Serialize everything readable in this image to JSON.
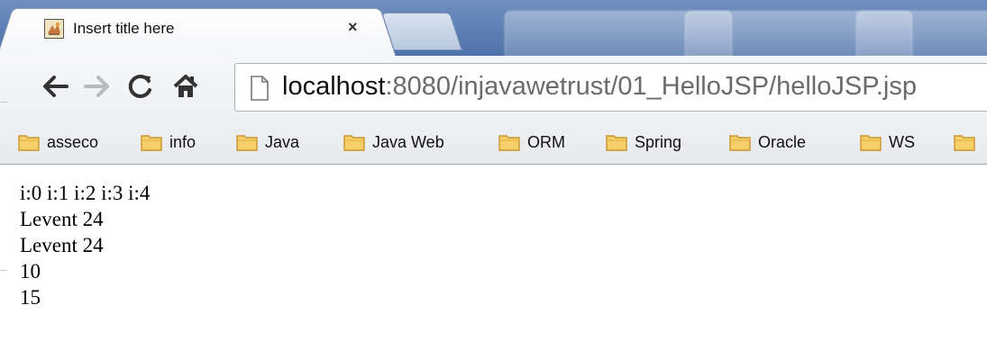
{
  "tab": {
    "title": "Insert title here",
    "close": "×"
  },
  "address": {
    "host": "localhost",
    "rest": ":8080/injavawetrust/01_HelloJSP/helloJSP.jsp"
  },
  "nav": {
    "back": "←",
    "forward": "→"
  },
  "bookmarks": [
    {
      "label": "asseco"
    },
    {
      "label": "info"
    },
    {
      "label": "Java"
    },
    {
      "label": "Java Web"
    },
    {
      "label": "ORM"
    },
    {
      "label": "Spring"
    },
    {
      "label": "Oracle"
    },
    {
      "label": "WS"
    },
    {
      "label": ""
    }
  ],
  "content": {
    "lines": [
      "i:0 i:1 i:2 i:3 i:4",
      "Levent 24",
      "Levent 24",
      "10",
      "15"
    ]
  },
  "colors": {
    "tabstrip": "#5a7bb1",
    "folder": "#f2c14e",
    "url_host": "#111111",
    "url_rest": "#6b6b6b"
  }
}
